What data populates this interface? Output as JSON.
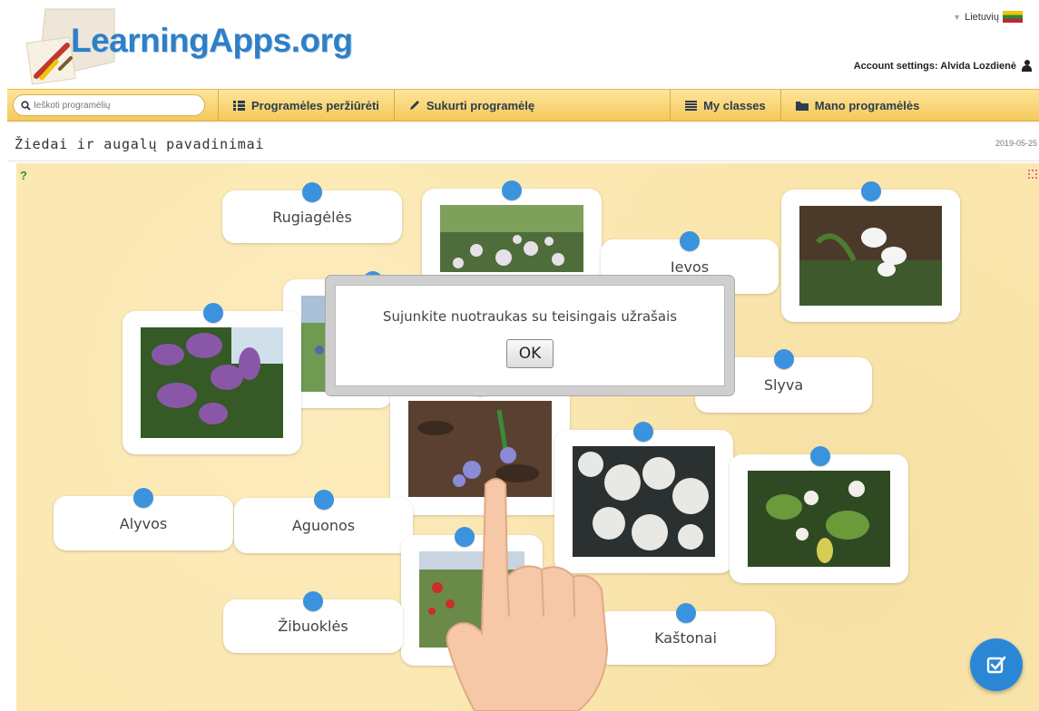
{
  "header": {
    "logo_text": "LearningApps.org",
    "language": "Lietuvių",
    "account": "Account settings: Alvida Lozdienė"
  },
  "nav": {
    "search_placeholder": "Ieškoti programėlių",
    "items": [
      {
        "label": "Programėles peržiūrėti",
        "icon": "grid-icon"
      },
      {
        "label": "Sukurti programėlę",
        "icon": "pencil-icon"
      },
      {
        "label": "My classes",
        "icon": "classes-icon"
      },
      {
        "label": "Mano programėlės",
        "icon": "folder-icon"
      }
    ]
  },
  "page": {
    "title": "Žiedai ir augalų pavadinimai",
    "date": "2019-05-25"
  },
  "cards": {
    "labels": [
      "Rugiagėlės",
      "Ievos",
      "Slyva",
      "Alyvos",
      "Aguonos",
      "Žibuoklės",
      "Kaštonai"
    ]
  },
  "dialog": {
    "message": "Sujunkite nuotraukas su teisingais užrašais",
    "ok_label": "OK"
  },
  "colors": {
    "accent_blue": "#3b93dd",
    "board": "#fbe7ae",
    "nav_bar": "#f3c95c",
    "logo": "#2f7fc6"
  }
}
